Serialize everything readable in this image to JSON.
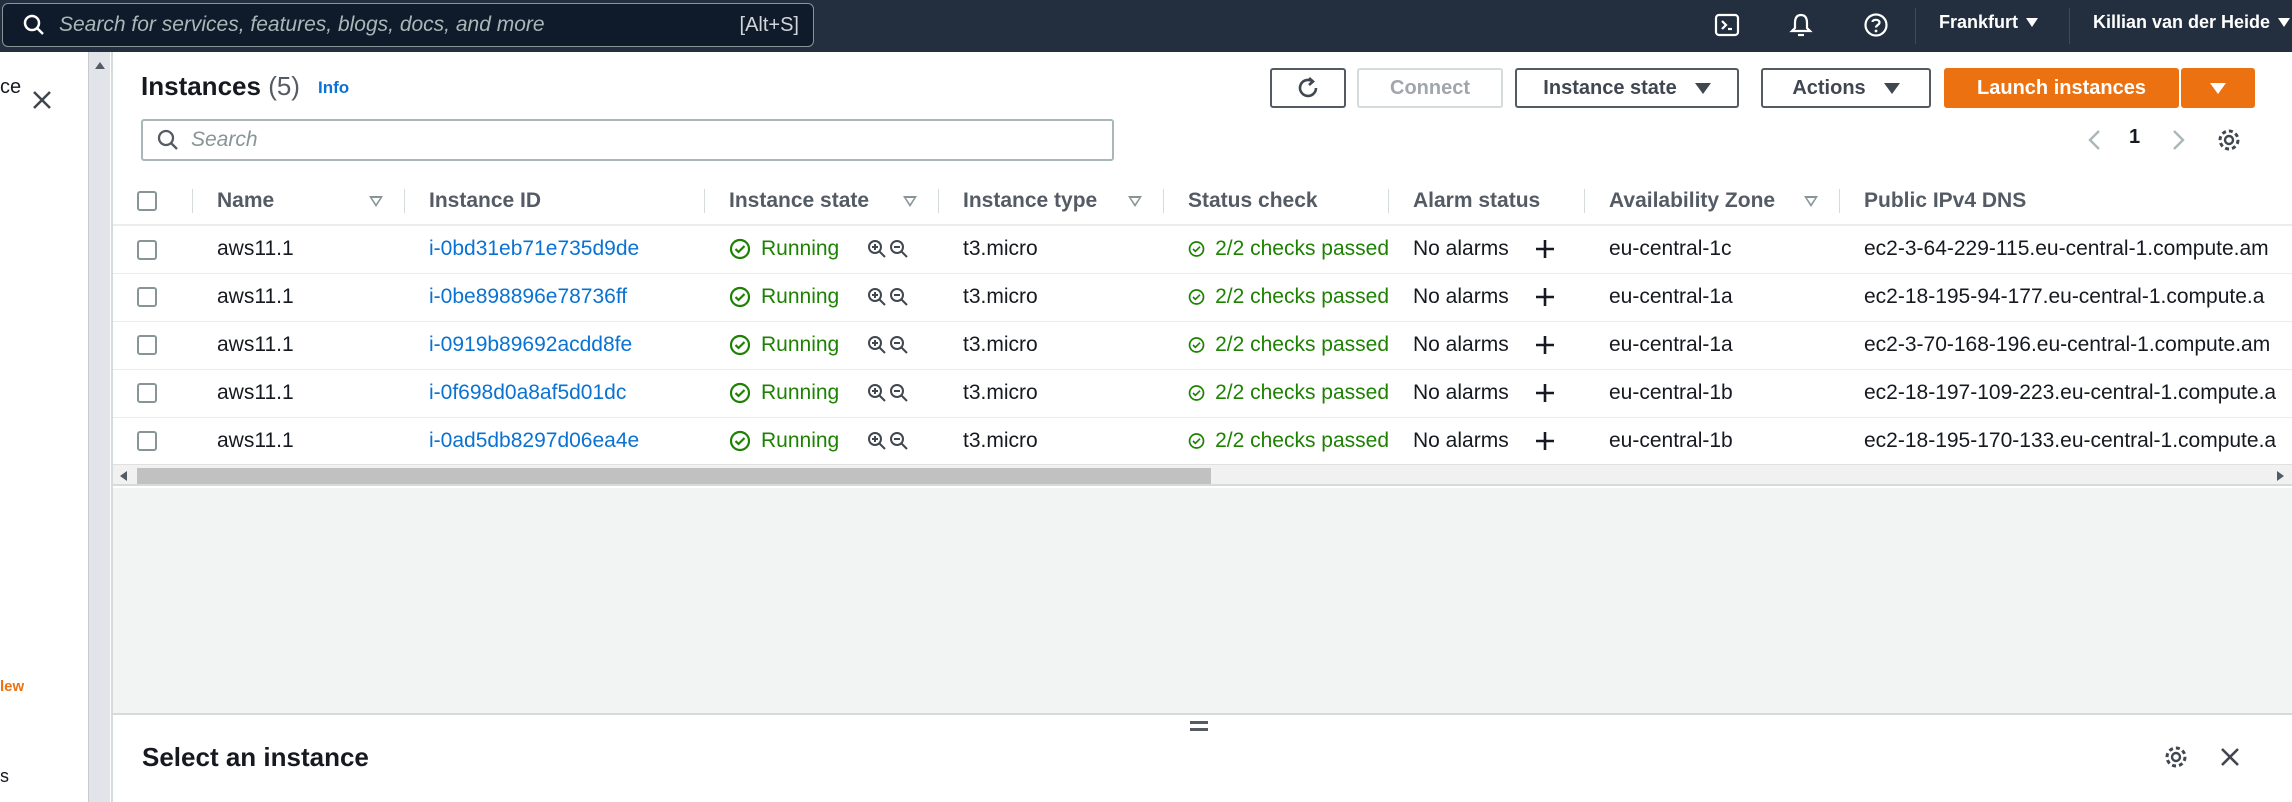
{
  "topbar": {
    "search_placeholder": "Search for services, features, blogs, docs, and more",
    "search_shortcut": "[Alt+S]",
    "region": "Frankfurt",
    "user": "Killian van der Heide"
  },
  "leftnav": {
    "partial_top": "ce",
    "partial_new": "lew",
    "partial_bottom": "s"
  },
  "header": {
    "title": "Instances",
    "count": "(5)",
    "info": "Info",
    "connect": "Connect",
    "instance_state": "Instance state",
    "actions": "Actions",
    "launch": "Launch instances"
  },
  "filter": {
    "placeholder": "Search"
  },
  "pagination": {
    "page": "1"
  },
  "table": {
    "columns": [
      "Name",
      "Instance ID",
      "Instance state",
      "Instance type",
      "Status check",
      "Alarm status",
      "Availability Zone",
      "Public IPv4 DNS"
    ],
    "rows": [
      {
        "name": "aws11.1",
        "id": "i-0bd31eb71e735d9de",
        "state": "Running",
        "type": "t3.micro",
        "status": "2/2 checks passed",
        "alarm": "No alarms",
        "az": "eu-central-1c",
        "dns": "ec2-3-64-229-115.eu-central-1.compute.am"
      },
      {
        "name": "aws11.1",
        "id": "i-0be898896e78736ff",
        "state": "Running",
        "type": "t3.micro",
        "status": "2/2 checks passed",
        "alarm": "No alarms",
        "az": "eu-central-1a",
        "dns": "ec2-18-195-94-177.eu-central-1.compute.a"
      },
      {
        "name": "aws11.1",
        "id": "i-0919b89692acdd8fe",
        "state": "Running",
        "type": "t3.micro",
        "status": "2/2 checks passed",
        "alarm": "No alarms",
        "az": "eu-central-1a",
        "dns": "ec2-3-70-168-196.eu-central-1.compute.am"
      },
      {
        "name": "aws11.1",
        "id": "i-0f698d0a8af5d01dc",
        "state": "Running",
        "type": "t3.micro",
        "status": "2/2 checks passed",
        "alarm": "No alarms",
        "az": "eu-central-1b",
        "dns": "ec2-18-197-109-223.eu-central-1.compute.a"
      },
      {
        "name": "aws11.1",
        "id": "i-0ad5db8297d06ea4e",
        "state": "Running",
        "type": "t3.micro",
        "status": "2/2 checks passed",
        "alarm": "No alarms",
        "az": "eu-central-1b",
        "dns": "ec2-18-195-170-133.eu-central-1.compute.a"
      }
    ]
  },
  "details_panel": {
    "title": "Select an instance"
  },
  "colors": {
    "accent": "#ec7211",
    "link": "#0972d3",
    "success": "#1d8102",
    "topbar": "#232f3e"
  }
}
